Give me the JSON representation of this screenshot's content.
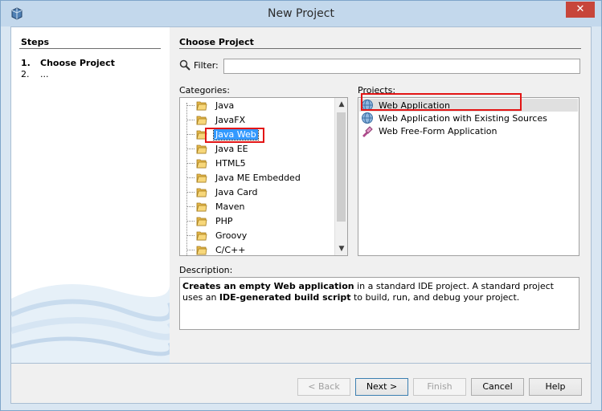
{
  "window": {
    "title": "New Project",
    "close_glyph": "✕"
  },
  "steps": {
    "title": "Steps",
    "items": [
      {
        "num": "1.",
        "label": "Choose Project"
      },
      {
        "num": "2.",
        "label": "..."
      }
    ]
  },
  "main": {
    "title": "Choose Project",
    "filter": {
      "label": "Filter:",
      "value": "",
      "placeholder": ""
    },
    "categories_label": "Categories:",
    "projects_label": "Projects:",
    "categories": [
      "Java",
      "JavaFX",
      "Java Web",
      "Java EE",
      "HTML5",
      "Java ME Embedded",
      "Java Card",
      "Maven",
      "PHP",
      "Groovy",
      "C/C++"
    ],
    "selected_category": "Java Web",
    "projects": [
      "Web Application",
      "Web Application with Existing Sources",
      "Web Free-Form Application"
    ],
    "selected_project": "Web Application",
    "description_label": "Description:",
    "description": {
      "b1": "Creates an empty Web application",
      "t1": " in a standard IDE project. A standard project uses an ",
      "b2": "IDE-generated build script",
      "t2": " to build, run, and debug your project."
    }
  },
  "buttons": {
    "back": "< Back",
    "next": "Next >",
    "finish": "Finish",
    "cancel": "Cancel",
    "help": "Help"
  },
  "colors": {
    "highlight": "#e31515",
    "selection": "#3399ff"
  }
}
